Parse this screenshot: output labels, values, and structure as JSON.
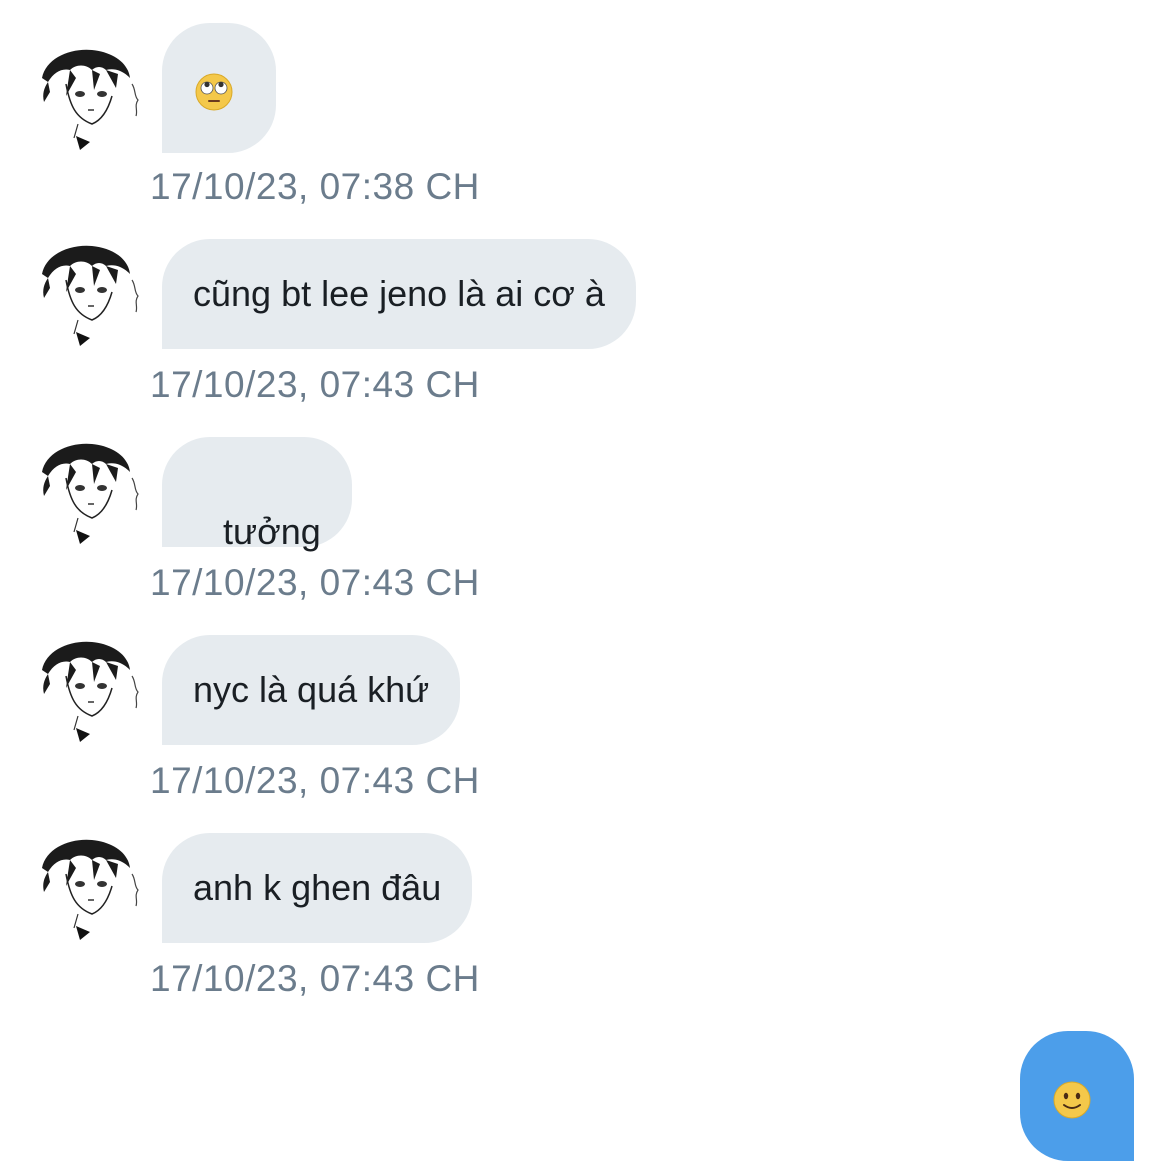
{
  "conversation": {
    "received": [
      {
        "kind": "emoji",
        "emoji_icon": "face-with-rolling-eyes-icon",
        "timestamp": "17/10/23, 07:38 CH"
      },
      {
        "kind": "text",
        "text": "cũng bt lee jeno là ai cơ à",
        "timestamp": "17/10/23, 07:43 CH"
      },
      {
        "kind": "text",
        "text": " tưởng",
        "timestamp": "17/10/23, 07:43 CH"
      },
      {
        "kind": "text",
        "text": "nyc là quá khứ",
        "timestamp": "17/10/23, 07:43 CH"
      },
      {
        "kind": "text",
        "text": "anh k ghen đâu",
        "timestamp": "17/10/23, 07:43 CH"
      }
    ],
    "sent": [
      {
        "kind": "emoji",
        "emoji_icon": "slightly-smiling-face-icon"
      }
    ]
  },
  "colors": {
    "received_bubble": "#e6ebef",
    "sent_bubble": "#4c9eea",
    "timestamp_text": "#6b7c8c"
  }
}
